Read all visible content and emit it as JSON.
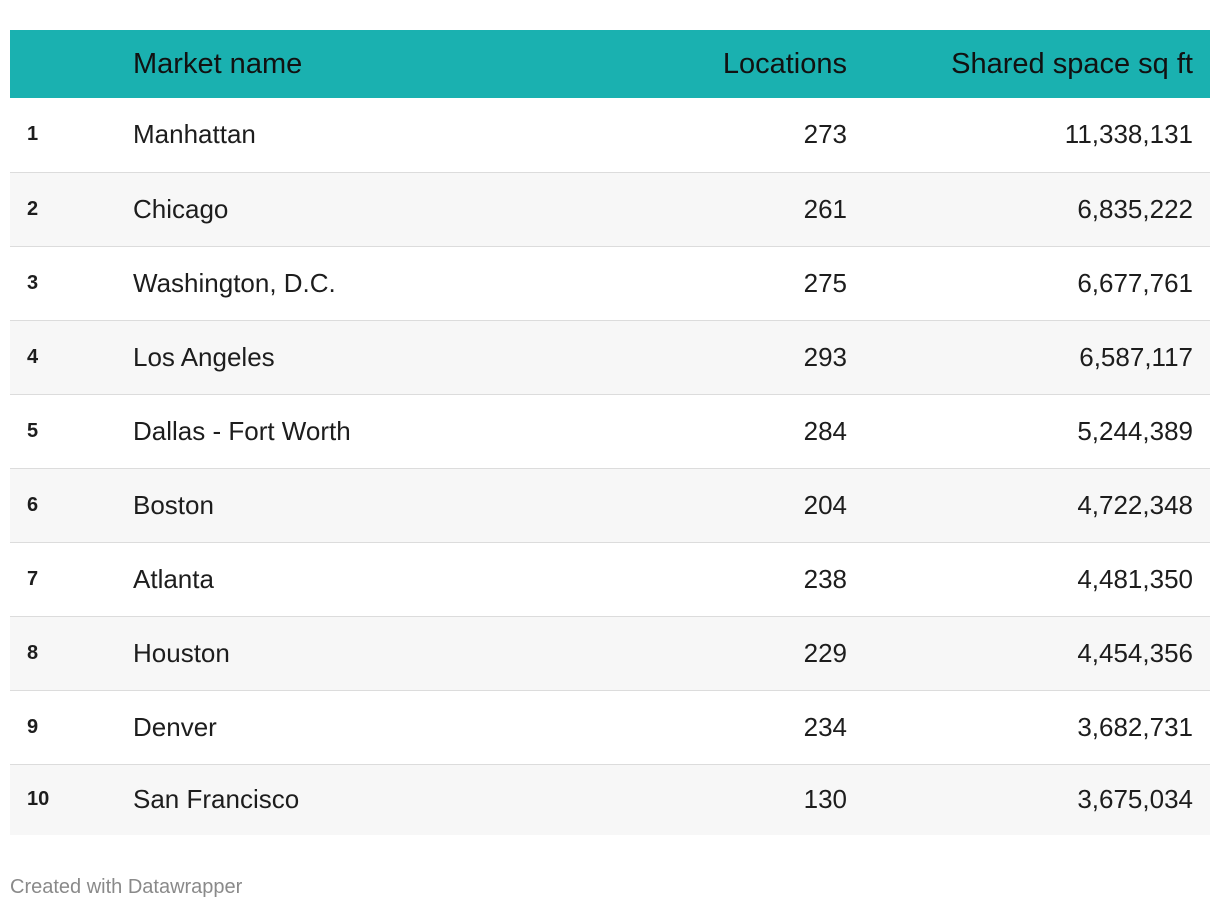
{
  "colors": {
    "header_bg": "#1ab1b0",
    "row_even_bg": "#ffffff",
    "row_odd_bg": "#f7f7f7",
    "row_divider": "#dcdcdc",
    "text": "#1d1d1d",
    "footer_text": "#8a8a8a"
  },
  "chart_data": {
    "type": "table",
    "columns": [
      "",
      "Market name",
      "Locations",
      "Shared space sq ft"
    ],
    "rows": [
      {
        "rank": "1",
        "market": "Manhattan",
        "locations": "273",
        "sqft": "11,338,131"
      },
      {
        "rank": "2",
        "market": "Chicago",
        "locations": "261",
        "sqft": "6,835,222"
      },
      {
        "rank": "3",
        "market": "Washington, D.C.",
        "locations": "275",
        "sqft": "6,677,761"
      },
      {
        "rank": "4",
        "market": "Los Angeles",
        "locations": "293",
        "sqft": "6,587,117"
      },
      {
        "rank": "5",
        "market": "Dallas - Fort Worth",
        "locations": "284",
        "sqft": "5,244,389"
      },
      {
        "rank": "6",
        "market": "Boston",
        "locations": "204",
        "sqft": "4,722,348"
      },
      {
        "rank": "7",
        "market": "Atlanta",
        "locations": "238",
        "sqft": "4,481,350"
      },
      {
        "rank": "8",
        "market": "Houston",
        "locations": "229",
        "sqft": "4,454,356"
      },
      {
        "rank": "9",
        "market": "Denver",
        "locations": "234",
        "sqft": "3,682,731"
      },
      {
        "rank": "10",
        "market": "San Francisco",
        "locations": "130",
        "sqft": "3,675,034"
      }
    ]
  },
  "footer": {
    "credit": "Created with Datawrapper"
  }
}
